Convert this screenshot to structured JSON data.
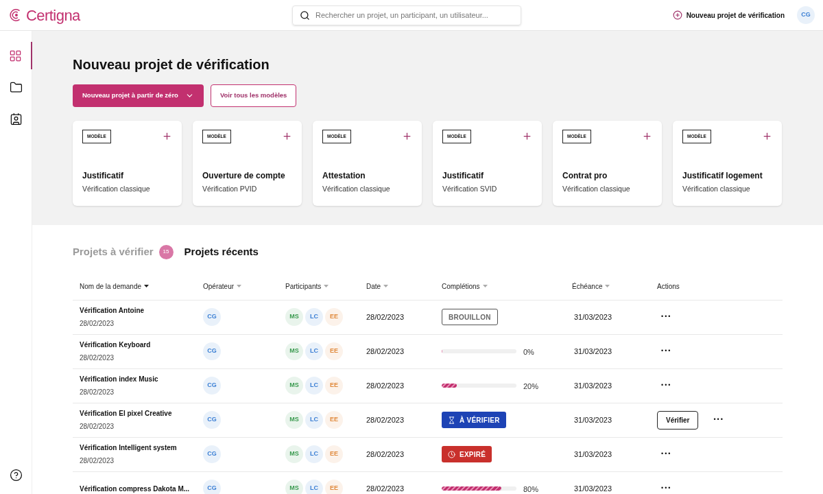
{
  "header": {
    "logo": "Certigna",
    "search": {
      "placeholder": "Rechercher un projet, un participant, un utilisateur..."
    },
    "new_project": "Nouveau projet de vérification",
    "avatar": {
      "initials": "CG",
      "color": "#3b7fd4"
    }
  },
  "sidebar": {
    "items": [
      {
        "kind": "grid",
        "selected": true
      },
      {
        "kind": "folder",
        "selected": false
      },
      {
        "kind": "contacts",
        "selected": false
      }
    ]
  },
  "hero": {
    "title": "Nouveau projet de vérification",
    "primary_button": "Nouveau projet à partir de zéro",
    "secondary_button": "Voir tous les modèles",
    "templates": [
      {
        "badge": "MODÈLE",
        "title": "Justificatif",
        "subtitle": "Vérification classique"
      },
      {
        "badge": "MODÈLE",
        "title": "Ouverture de compte",
        "subtitle": "Vérification PVID"
      },
      {
        "badge": "MODÈLE",
        "title": "Attestation",
        "subtitle": "Vérification classique"
      },
      {
        "badge": "MODÈLE",
        "title": "Justificatif",
        "subtitle": "Vérification SVID"
      },
      {
        "badge": "MODÈLE",
        "title": "Contrat pro",
        "subtitle": "Vérification classique"
      },
      {
        "badge": "MODÈLE",
        "title": "Justificatif logement",
        "subtitle": "Vérification classique"
      }
    ]
  },
  "tabs": [
    {
      "label": "Projets à vérifier",
      "count": "15",
      "selected": false
    },
    {
      "label": "Projets récents",
      "selected": true
    }
  ],
  "table": {
    "columns": [
      {
        "label": "Nom de la demande",
        "kind": "sortable",
        "sorted": true
      },
      {
        "label": "Opérateur",
        "kind": "sortable",
        "sorted": false
      },
      {
        "label": "Participants",
        "kind": "sortable",
        "sorted": false
      },
      {
        "label": "Date",
        "kind": "sortable",
        "sorted": false
      },
      {
        "label": "Complétions",
        "kind": "sortable",
        "sorted": false
      },
      {
        "label": "Échéance",
        "kind": "sortable",
        "sorted": false
      },
      {
        "label": "Actions",
        "kind": "plain"
      }
    ],
    "rows": [
      {
        "name": "Vérification Antoine",
        "created": "28/02/2023",
        "operator": {
          "initials": "CG",
          "color": "#3b7fd4"
        },
        "participants": [
          {
            "initials": "MS",
            "color": "#3a9a4f"
          },
          {
            "initials": "LC",
            "color": "#3b7fd4"
          },
          {
            "initials": "EE",
            "color": "#e08a3c"
          }
        ],
        "date": "28/02/2023",
        "completion": {
          "kind": "draft",
          "label": "BROUILLON"
        },
        "due": "31/03/2023",
        "more": "•••"
      },
      {
        "name": "Vérification Keyboard",
        "created": "28/02/2023",
        "operator": {
          "initials": "CG",
          "color": "#3b7fd4"
        },
        "participants": [
          {
            "initials": "MS",
            "color": "#3a9a4f"
          },
          {
            "initials": "LC",
            "color": "#3b7fd4"
          },
          {
            "initials": "EE",
            "color": "#e08a3c"
          }
        ],
        "date": "28/02/2023",
        "completion": {
          "kind": "progress",
          "level": 0,
          "reading": "0%"
        },
        "due": "31/03/2023",
        "more": "•••"
      },
      {
        "name": "Vérification index Music",
        "created": "28/02/2023",
        "operator": {
          "initials": "CG",
          "color": "#3b7fd4"
        },
        "participants": [
          {
            "initials": "MS",
            "color": "#3a9a4f"
          },
          {
            "initials": "LC",
            "color": "#3b7fd4"
          },
          {
            "initials": "EE",
            "color": "#e08a3c"
          }
        ],
        "date": "28/02/2023",
        "completion": {
          "kind": "progress",
          "level": 0.2,
          "reading": "20%"
        },
        "due": "31/03/2023",
        "more": "•••"
      },
      {
        "name": "Vérification El pixel Creative",
        "created": "28/02/2023",
        "operator": {
          "initials": "CG",
          "color": "#3b7fd4"
        },
        "participants": [
          {
            "initials": "MS",
            "color": "#3a9a4f"
          },
          {
            "initials": "LC",
            "color": "#3b7fd4"
          },
          {
            "initials": "EE",
            "color": "#e08a3c"
          }
        ],
        "date": "28/02/2023",
        "completion": {
          "kind": "to_verify",
          "label": "À VÉRIFIER"
        },
        "due": "31/03/2023",
        "verify_button": "Vérifier",
        "more": "•••"
      },
      {
        "name": "Vérification Intelligent system",
        "created": "28/02/2023",
        "operator": {
          "initials": "CG",
          "color": "#3b7fd4"
        },
        "participants": [
          {
            "initials": "MS",
            "color": "#3a9a4f"
          },
          {
            "initials": "LC",
            "color": "#3b7fd4"
          },
          {
            "initials": "EE",
            "color": "#e08a3c"
          }
        ],
        "date": "28/02/2023",
        "completion": {
          "kind": "expired",
          "label": "EXPIRÉ"
        },
        "due": "31/03/2023",
        "more": "•••"
      },
      {
        "name": "Vérification compress Dakota M...",
        "operator": {
          "initials": "CG",
          "color": "#3b7fd4"
        },
        "participants": [
          {
            "initials": "MS",
            "color": "#3a9a4f"
          },
          {
            "initials": "LC",
            "color": "#3b7fd4"
          },
          {
            "initials": "EE",
            "color": "#e08a3c"
          }
        ],
        "date": "28/02/2023",
        "completion": {
          "kind": "progress",
          "level": 0.8,
          "reading": "80%"
        },
        "due": "31/03/2023",
        "more": "•••"
      }
    ]
  }
}
